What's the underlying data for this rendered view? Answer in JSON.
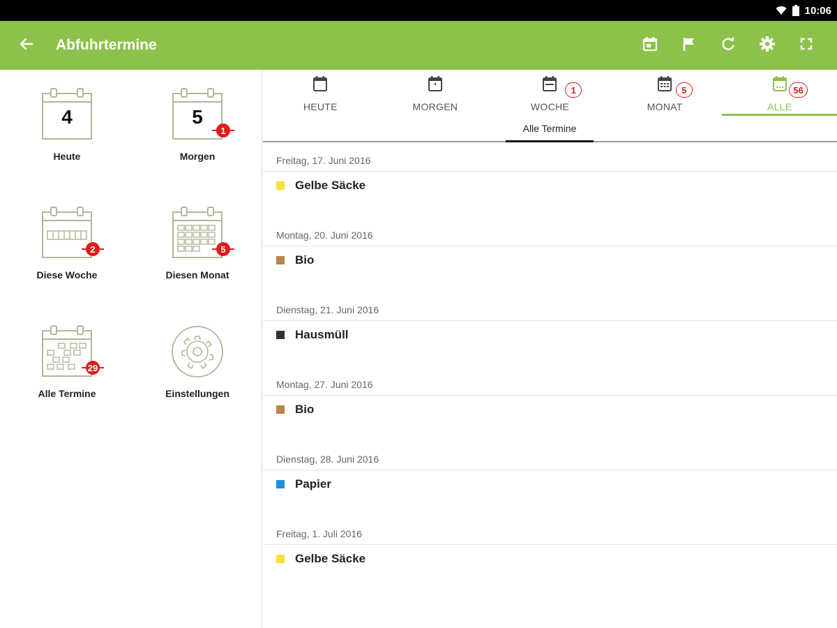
{
  "status_bar": {
    "time": "10:06",
    "icons": [
      "wifi-icon",
      "battery-icon"
    ]
  },
  "app_bar": {
    "title": "Abfuhrtermine",
    "back_icon": "arrow-left-icon",
    "actions": [
      "calendar-today-icon",
      "flag-icon",
      "refresh-icon",
      "settings-icon",
      "fullscreen-icon"
    ]
  },
  "sidebar": {
    "tiles": [
      {
        "label": "Heute",
        "icon": "calendar-day-icon",
        "number": "4",
        "badge": ""
      },
      {
        "label": "Morgen",
        "icon": "calendar-day-icon",
        "number": "5",
        "badge": "1"
      },
      {
        "label": "Diese Woche",
        "icon": "calendar-week-icon",
        "badge": "2"
      },
      {
        "label": "Diesen Monat",
        "icon": "calendar-month-icon",
        "badge": "5"
      },
      {
        "label": "Alle Termine",
        "icon": "calendar-all-icon",
        "badge": "29"
      },
      {
        "label": "Einstellungen",
        "icon": "gear-icon",
        "badge": ""
      }
    ]
  },
  "tabs": {
    "items": [
      {
        "label": "HEUTE",
        "count": "",
        "active": false
      },
      {
        "label": "MORGEN",
        "count": "",
        "active": false
      },
      {
        "label": "WOCHE",
        "count": "1",
        "active": false
      },
      {
        "label": "MONAT",
        "count": "5",
        "active": false
      },
      {
        "label": "ALLE",
        "count": "56",
        "active": true
      }
    ],
    "subtab": "Alle Termine"
  },
  "schedule": [
    {
      "date": "Freitag, 17. Juni 2016",
      "type": "Gelbe Säcke",
      "color": "#f7e23a"
    },
    {
      "date": "Montag, 20. Juni 2016",
      "type": "Bio",
      "color": "#b8864a"
    },
    {
      "date": "Dienstag, 21. Juni 2016",
      "type": "Hausmüll",
      "color": "#333333"
    },
    {
      "date": "Montag, 27. Juni 2016",
      "type": "Bio",
      "color": "#b8864a"
    },
    {
      "date": "Dienstag, 28. Juni 2016",
      "type": "Papier",
      "color": "#1e90d6"
    },
    {
      "date": "Freitag, 1. Juli 2016",
      "type": "Gelbe Säcke",
      "color": "#f7e23a"
    }
  ],
  "colors": {
    "accent": "#8dc14b",
    "badge": "#e21b1b",
    "icon_outline": "#b5b59a"
  }
}
